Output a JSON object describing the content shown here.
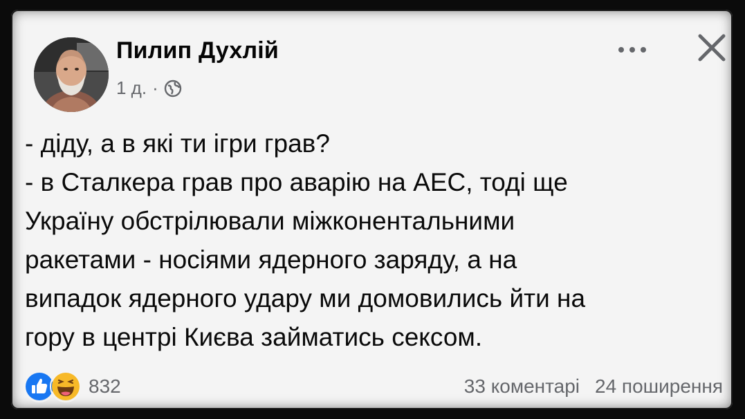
{
  "post": {
    "author": "Пилип Духлій",
    "time": "1 д.",
    "separator": "·",
    "privacy_icon": "globe-icon",
    "more_icon": "more-horizontal-icon",
    "close_icon": "close-icon",
    "lines": [
      "- діду, а в які ти ігри грав?",
      "- в Сталкера грав про аварію на АЕС, тоді ще",
      "Україну обстрілювали міжконентальними",
      "ракетами - носіями ядерного заряду, а на",
      "випадок ядерного удару ми домовились йти на",
      "гору в центрі Києва займатись сексом."
    ]
  },
  "footer": {
    "reaction_icons": [
      "like-icon",
      "haha-icon"
    ],
    "reaction_count": "832",
    "comments": "33 коментарі",
    "shares": "24 поширення"
  },
  "colors": {
    "card_bg": "#f4f4f4",
    "text": "#050505",
    "secondary_text": "#65676b",
    "like_blue": "#1877f2",
    "haha_yellow": "#f7b928"
  }
}
